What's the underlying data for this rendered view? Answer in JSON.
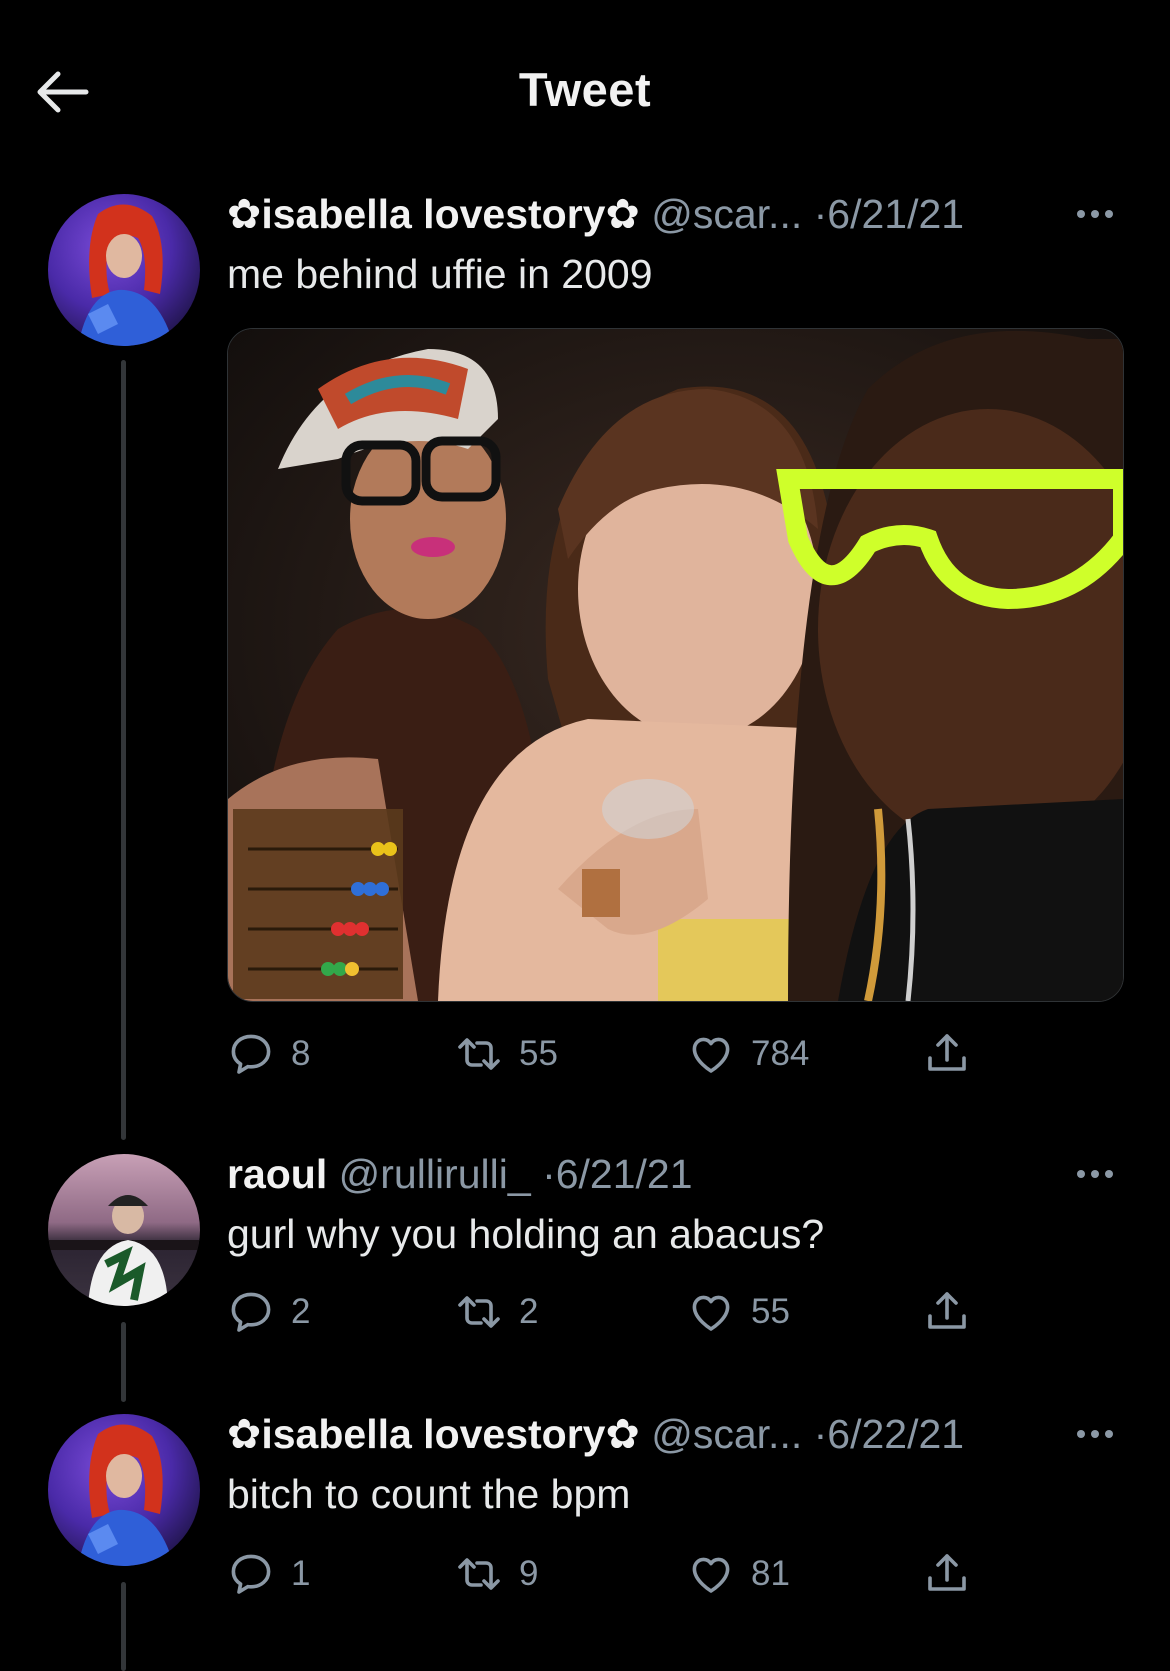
{
  "header": {
    "title": "Tweet"
  },
  "tweets": [
    {
      "name": "✿isabella lovestory✿",
      "handle": "@scar...",
      "dot": "·",
      "date": "6/21/21",
      "text": "me behind uffie in 2009",
      "replies": "8",
      "retweets": "55",
      "likes": "784"
    },
    {
      "name": "raoul",
      "handle": "@rullirulli_",
      "dot": "·",
      "date": "6/21/21",
      "text": "gurl why you holding an abacus?",
      "replies": "2",
      "retweets": "2",
      "likes": "55"
    },
    {
      "name": "✿isabella lovestory✿",
      "handle": "@scar...",
      "dot": "·",
      "date": "6/22/21",
      "text": "bitch to count the bpm",
      "replies": "1",
      "retweets": "9",
      "likes": "81"
    }
  ],
  "colors": {
    "background": "#000000",
    "text": "#e7e9ea",
    "muted": "#8b98a5",
    "thread_line": "#333639"
  }
}
